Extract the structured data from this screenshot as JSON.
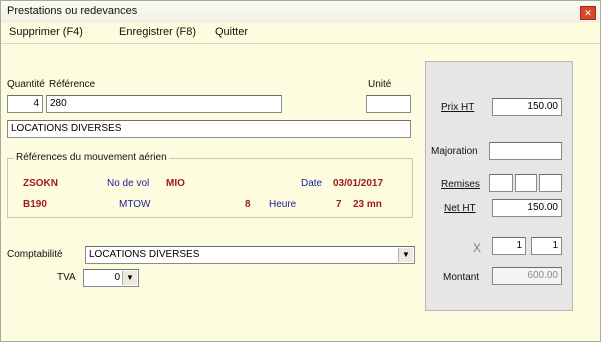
{
  "window": {
    "title": "Prestations ou redevances"
  },
  "menu": {
    "delete": "Supprimer (F4)",
    "save": "Enregistrer (F8)",
    "quit": "Quitter"
  },
  "form": {
    "quantite_label": "Quantité",
    "reference_label": "Référence",
    "unite_label": "Unité",
    "quantite": "4",
    "reference": "280",
    "unite": "",
    "description": "LOCATIONS DIVERSES"
  },
  "movement": {
    "group_title": "Références du mouvement aérien",
    "code1": "ZSOKN",
    "vol_label": "No de vol",
    "vol_value": "MIO",
    "date_label": "Date",
    "date_value": "03/01/2017",
    "code2": "B190",
    "mtow_label": "MTOW",
    "mtow_value": "8",
    "heure_label": "Heure",
    "heure_h": "7",
    "heure_m": "23 mn"
  },
  "accounting": {
    "compta_label": "Comptabilité",
    "compta_value": "LOCATIONS DIVERSES",
    "tva_label": "TVA",
    "tva_value": "0"
  },
  "pricing": {
    "prix_ht_label": "Prix HT",
    "prix_ht": "150.00",
    "majoration_label": "Majoration",
    "majoration": "",
    "remises_label": "Remises",
    "net_ht_label": "Net HT",
    "net_ht": "150.00",
    "mult_symbol": "X",
    "mult_a": "1",
    "mult_b": "1",
    "montant_label": "Montant",
    "montant": "600.00"
  }
}
